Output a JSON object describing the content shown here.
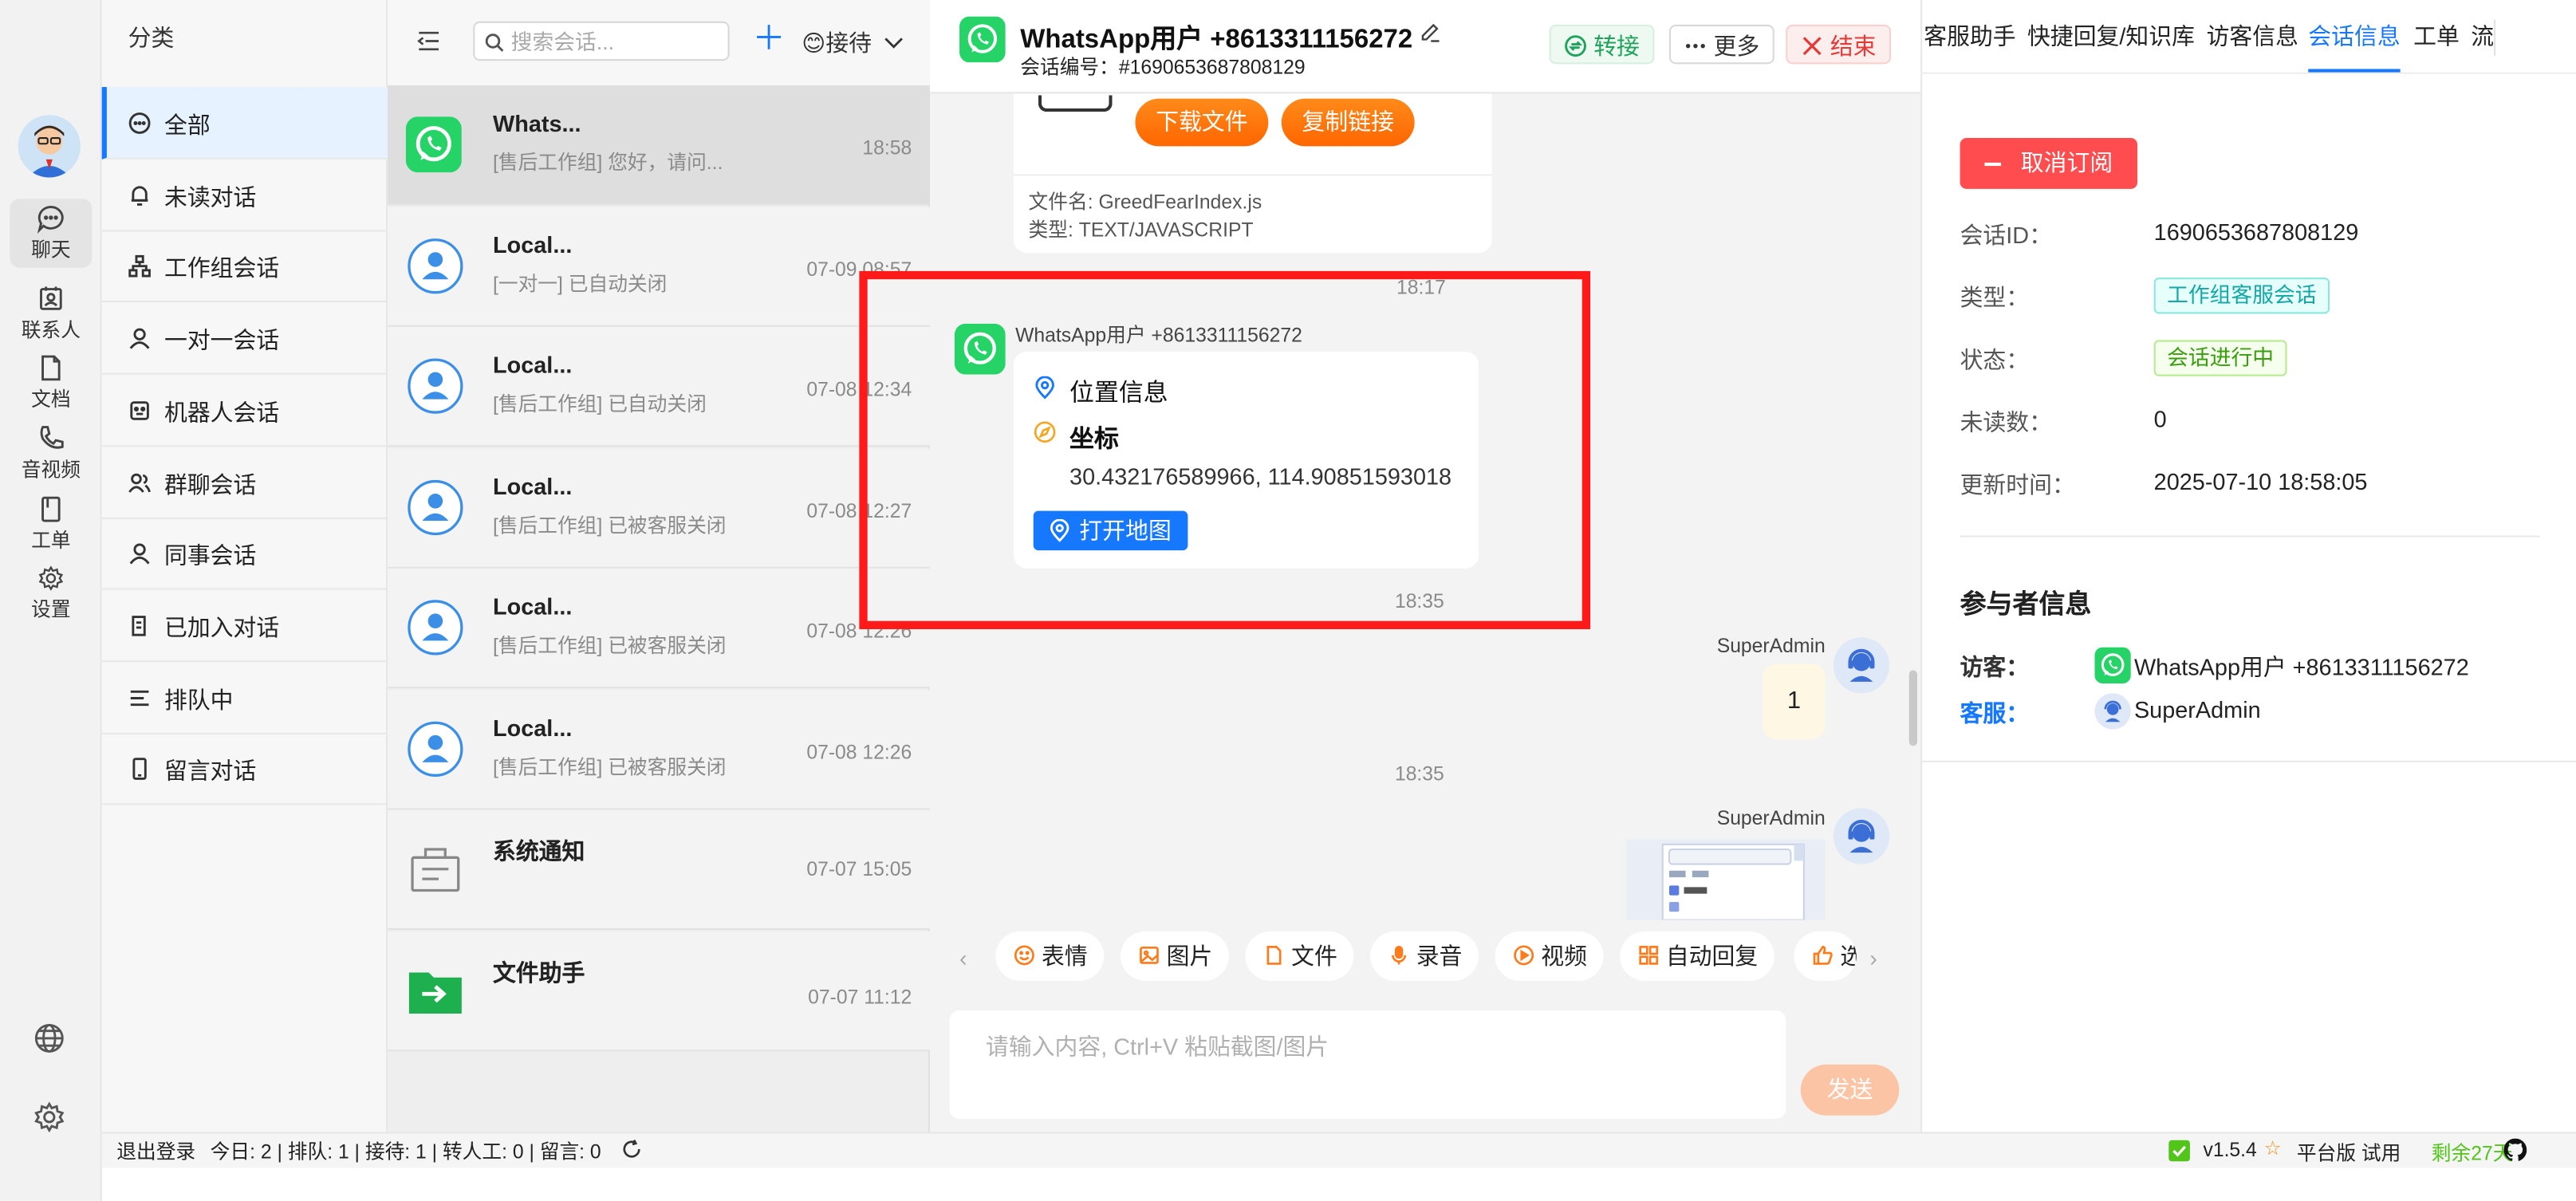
{
  "rail": {
    "items": [
      {
        "label": "聊天",
        "icon": "chat-icon",
        "active": true
      },
      {
        "label": "联系人",
        "icon": "contacts-icon"
      },
      {
        "label": "文档",
        "icon": "document-icon"
      },
      {
        "label": "音视频",
        "icon": "phone-icon"
      },
      {
        "label": "工单",
        "icon": "ticket-icon"
      },
      {
        "label": "设置",
        "icon": "gear-icon"
      }
    ],
    "bottom_icons": [
      "globe-icon",
      "gear-icon"
    ]
  },
  "categories": {
    "title": "分类",
    "items": [
      {
        "label": "全部",
        "icon": "chat-bubble-icon",
        "active": true
      },
      {
        "label": "未读对话",
        "icon": "bell-icon"
      },
      {
        "label": "工作组会话",
        "icon": "org-icon"
      },
      {
        "label": "一对一会话",
        "icon": "user-icon"
      },
      {
        "label": "机器人会话",
        "icon": "robot-icon"
      },
      {
        "label": "群聊会话",
        "icon": "group-icon"
      },
      {
        "label": "同事会话",
        "icon": "user-icon"
      },
      {
        "label": "已加入对话",
        "icon": "joined-icon"
      },
      {
        "label": "排队中",
        "icon": "queue-icon"
      },
      {
        "label": "留言对话",
        "icon": "mobile-icon"
      }
    ]
  },
  "conv_header": {
    "search_placeholder": "搜索会话...",
    "status_label": "😊接待"
  },
  "conversations": [
    {
      "name": "Whats...",
      "preview": "[售后工作组] 您好，请问...",
      "time": "18:58",
      "avatar": "whatsapp",
      "active": true
    },
    {
      "name": "Local...",
      "preview": "[一对一] 已自动关闭",
      "time": "07-09 08:57",
      "avatar": "user"
    },
    {
      "name": "Local...",
      "preview": "[售后工作组] 已自动关闭",
      "time": "07-08 12:34",
      "avatar": "user"
    },
    {
      "name": "Local...",
      "preview": "[售后工作组] 已被客服关闭",
      "time": "07-08 12:27",
      "avatar": "user"
    },
    {
      "name": "Local...",
      "preview": "[售后工作组] 已被客服关闭",
      "time": "07-08 12:26",
      "avatar": "user"
    },
    {
      "name": "Local...",
      "preview": "[售后工作组] 已被客服关闭",
      "time": "07-08 12:26",
      "avatar": "user"
    },
    {
      "name": "系统通知",
      "preview": "",
      "time": "07-07 15:05",
      "avatar": "notice"
    },
    {
      "name": "文件助手",
      "preview": "",
      "time": "07-07 11:12",
      "avatar": "folder"
    }
  ],
  "chat": {
    "title": "WhatsApp用户 +8613311156272",
    "session_id": "会话编号：#1690653687808129",
    "buttons": {
      "transfer": "转接",
      "more": "更多",
      "end": "结束"
    },
    "file_msg": {
      "download": "下载文件",
      "copy_link": "复制链接",
      "file_name": "文件名: GreedFearIndex.js",
      "file_type": "类型: TEXT/JAVASCRIPT",
      "time": "18:17"
    },
    "location_msg": {
      "sender": "WhatsApp用户 +8613311156272",
      "title": "位置信息",
      "coord_label": "坐标",
      "coords": "30.432176589966, 114.90851593018",
      "open_map": "打开地图",
      "time": "18:35"
    },
    "agent_msg": {
      "sender": "SuperAdmin",
      "text": "1"
    },
    "time2": "18:35",
    "agent_msg2": {
      "sender": "SuperAdmin"
    },
    "toolbar": [
      {
        "label": "表情",
        "icon": "emoji-icon"
      },
      {
        "label": "图片",
        "icon": "image-icon"
      },
      {
        "label": "文件",
        "icon": "file-icon"
      },
      {
        "label": "录音",
        "icon": "mic-icon"
      },
      {
        "label": "视频",
        "icon": "video-icon"
      },
      {
        "label": "自动回复",
        "icon": "grid-icon"
      },
      {
        "label": "选",
        "icon": "thumb-icon"
      }
    ],
    "input_placeholder": "请输入内容, Ctrl+V 粘贴截图/图片",
    "send": "发送"
  },
  "right_panel": {
    "tabs": [
      {
        "label": "客服助手"
      },
      {
        "label": "快捷回复/知识库"
      },
      {
        "label": "访客信息"
      },
      {
        "label": "会话信息",
        "active": true
      },
      {
        "label": "工单"
      },
      {
        "label": "流"
      }
    ],
    "unsubscribe": "取消订阅",
    "fields": [
      {
        "label": "会话ID：",
        "value": "1690653687808129"
      },
      {
        "label": "类型：",
        "tag": "工作组客服会话",
        "tag_style": "cyan"
      },
      {
        "label": "状态：",
        "tag": "会话进行中",
        "tag_style": "green"
      },
      {
        "label": "未读数：",
        "value": "0"
      },
      {
        "label": "更新时间：",
        "value": "2025-07-10 18:58:05"
      }
    ],
    "participants_title": "参与者信息",
    "participants": [
      {
        "label": "访客：",
        "value": "WhatsApp用户 +8613311156272",
        "icon": "whatsapp"
      },
      {
        "label": "客服：",
        "value": "SuperAdmin",
        "icon": "agent"
      }
    ]
  },
  "statusbar": {
    "logout": "退出登录",
    "stats": "今日: 2 | 排队: 1 | 接待: 1 | 转人工: 0 | 留言: 0",
    "version": "v1.5.4",
    "plan": "平台版 试用",
    "days_left": "剩余27天"
  },
  "colors": {
    "accent": "#1677ff",
    "danger": "#ff4d4f",
    "whatsapp": "#25d366",
    "highlight": "#ff1a1a"
  }
}
